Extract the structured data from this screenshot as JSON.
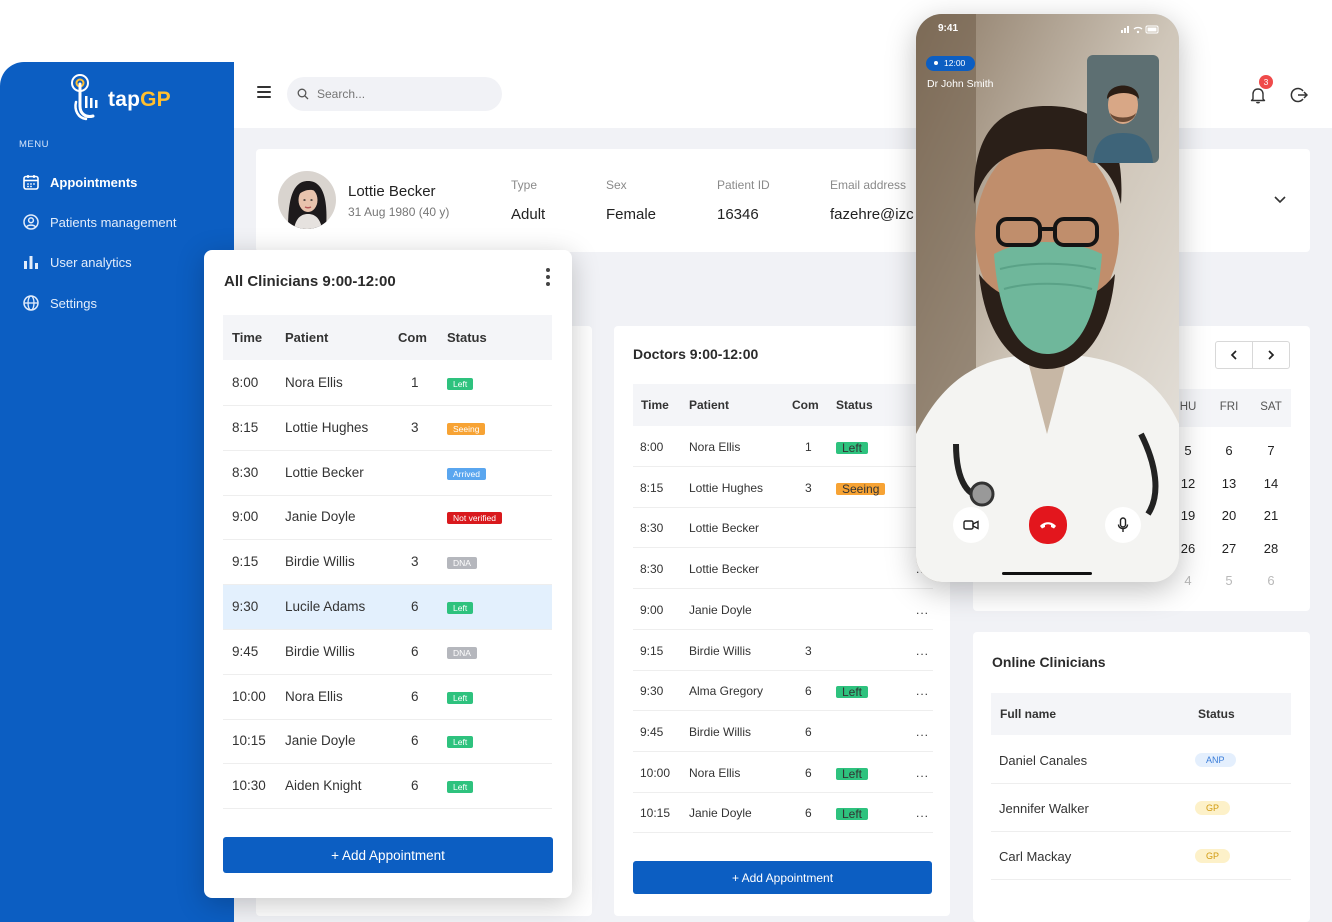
{
  "app": {
    "brand_prefix": "tap",
    "brand_suffix": "GP",
    "accent": "#0c5ec2"
  },
  "sidebar": {
    "menu_label": "MENU",
    "items": [
      {
        "label": "Appointments",
        "icon": "calendar-icon",
        "active": true
      },
      {
        "label": "Patients management",
        "icon": "user-circle-icon"
      },
      {
        "label": "User analytics",
        "icon": "bar-chart-icon"
      },
      {
        "label": "Settings",
        "icon": "globe-icon"
      }
    ]
  },
  "topbar": {
    "search_placeholder": "Search...",
    "notifications": "3"
  },
  "patient": {
    "name": "Lottie Becker",
    "dob": "31 Aug 1980 (40 y)",
    "fields": [
      {
        "label": "Type",
        "value": "Adult"
      },
      {
        "label": "Sex",
        "value": "Female"
      },
      {
        "label": "Patient ID",
        "value": "16346"
      },
      {
        "label": "Email address",
        "value": "fazehre@izc"
      }
    ]
  },
  "all_clinicians": {
    "title": "All Clinicians 9:00-12:00",
    "headers": [
      "Time",
      "Patient",
      "Com",
      "Status"
    ],
    "rows": [
      {
        "time": "8:00",
        "patient": "Nora Ellis",
        "com": "1",
        "status": "Left"
      },
      {
        "time": "8:15",
        "patient": "Lottie Hughes",
        "com": "3",
        "status": "Seeing"
      },
      {
        "time": "8:30",
        "patient": "Lottie Becker",
        "com": "",
        "status": "Arrived"
      },
      {
        "time": "9:00",
        "patient": "Janie Doyle",
        "com": "",
        "status": "Not verified"
      },
      {
        "time": "9:15",
        "patient": "Birdie Willis",
        "com": "3",
        "status": "DNA"
      },
      {
        "time": "9:30",
        "patient": "Lucile Adams",
        "com": "6",
        "status": "Left"
      },
      {
        "time": "9:45",
        "patient": "Birdie Willis",
        "com": "6",
        "status": "DNA"
      },
      {
        "time": "10:00",
        "patient": "Nora Ellis",
        "com": "6",
        "status": "Left"
      },
      {
        "time": "10:15",
        "patient": "Janie Doyle",
        "com": "6",
        "status": "Left"
      },
      {
        "time": "10:30",
        "patient": "Aiden Knight",
        "com": "6",
        "status": "Left"
      }
    ],
    "add_button": "+ Add Appointment"
  },
  "doctors": {
    "title": "Doctors 9:00-12:00",
    "headers": [
      "Time",
      "Patient",
      "Com",
      "Status"
    ],
    "rows": [
      {
        "time": "8:00",
        "patient": "Nora Ellis",
        "com": "1",
        "status": "Left",
        "more": "..."
      },
      {
        "time": "8:15",
        "patient": "Lottie Hughes",
        "com": "3",
        "status": "Seeing",
        "more": "..."
      },
      {
        "time": "8:30",
        "patient": "Lottie Becker",
        "com": "",
        "status": "",
        "more": "..."
      },
      {
        "time": "8:30",
        "patient": "Lottie Becker",
        "com": "",
        "status": "",
        "more": "..."
      },
      {
        "time": "9:00",
        "patient": "Janie Doyle",
        "com": "",
        "status": "",
        "more": "..."
      },
      {
        "time": "9:15",
        "patient": "Birdie Willis",
        "com": "3",
        "status": "",
        "more": "..."
      },
      {
        "time": "9:30",
        "patient": "Alma Gregory",
        "com": "6",
        "status": "Left",
        "more": "..."
      },
      {
        "time": "9:45",
        "patient": "Birdie Willis",
        "com": "6",
        "status": "",
        "more": "..."
      },
      {
        "time": "10:00",
        "patient": "Nora Ellis",
        "com": "6",
        "status": "Left",
        "more": "..."
      },
      {
        "time": "10:15",
        "patient": "Janie Doyle",
        "com": "6",
        "status": "Left",
        "more": "..."
      }
    ],
    "add_button": "+ Add Appointment"
  },
  "calendar": {
    "day_headers": [
      "HU",
      "FRI",
      "SAT"
    ],
    "weeks": [
      [
        "5",
        "6",
        "7"
      ],
      [
        "12",
        "13",
        "14"
      ],
      [
        "19",
        "20",
        "21"
      ],
      [
        "26",
        "27",
        "28"
      ],
      [
        "4",
        "5",
        "6"
      ]
    ],
    "partial_row": [
      "20"
    ]
  },
  "online_clinicians": {
    "title": "Online Clinicians",
    "headers": [
      "Full name",
      "Status"
    ],
    "rows": [
      {
        "name": "Daniel Canales",
        "role": "ANP"
      },
      {
        "name": "Jennifer Walker",
        "role": "GP"
      },
      {
        "name": "Carl Mackay",
        "role": "GP"
      }
    ]
  },
  "call": {
    "clock": "9:41",
    "duration": "12:00",
    "caller": "Dr John Smith"
  }
}
